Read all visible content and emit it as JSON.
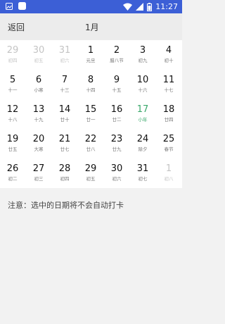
{
  "status_bar": {
    "time": "11:27",
    "icons": [
      "notification-icon",
      "app-icon",
      "wifi-icon",
      "signal-icon",
      "battery-icon"
    ],
    "color": "#3c5fd6"
  },
  "header": {
    "back_label": "返回",
    "month_title": "1月"
  },
  "calendar": {
    "today_color": "#3aa86b",
    "weeks": [
      [
        {
          "day": "29",
          "lunar": "初四",
          "faded": true
        },
        {
          "day": "30",
          "lunar": "初五",
          "faded": true
        },
        {
          "day": "31",
          "lunar": "初六",
          "faded": true
        },
        {
          "day": "1",
          "lunar": "元旦"
        },
        {
          "day": "2",
          "lunar": "腊八节"
        },
        {
          "day": "3",
          "lunar": "初九"
        },
        {
          "day": "4",
          "lunar": "初十"
        }
      ],
      [
        {
          "day": "5",
          "lunar": "十一"
        },
        {
          "day": "6",
          "lunar": "小寒"
        },
        {
          "day": "7",
          "lunar": "十三"
        },
        {
          "day": "8",
          "lunar": "十四"
        },
        {
          "day": "9",
          "lunar": "十五"
        },
        {
          "day": "10",
          "lunar": "十六"
        },
        {
          "day": "11",
          "lunar": "十七"
        }
      ],
      [
        {
          "day": "12",
          "lunar": "十八"
        },
        {
          "day": "13",
          "lunar": "十九"
        },
        {
          "day": "14",
          "lunar": "廿十"
        },
        {
          "day": "15",
          "lunar": "廿一"
        },
        {
          "day": "16",
          "lunar": "廿二"
        },
        {
          "day": "17",
          "lunar": "小年",
          "today": true
        },
        {
          "day": "18",
          "lunar": "廿四"
        }
      ],
      [
        {
          "day": "19",
          "lunar": "廿五"
        },
        {
          "day": "20",
          "lunar": "大寒"
        },
        {
          "day": "21",
          "lunar": "廿七"
        },
        {
          "day": "22",
          "lunar": "廿八"
        },
        {
          "day": "23",
          "lunar": "廿九"
        },
        {
          "day": "24",
          "lunar": "除夕"
        },
        {
          "day": "25",
          "lunar": "春节"
        }
      ],
      [
        {
          "day": "26",
          "lunar": "初二"
        },
        {
          "day": "27",
          "lunar": "初三"
        },
        {
          "day": "28",
          "lunar": "初四"
        },
        {
          "day": "29",
          "lunar": "初五"
        },
        {
          "day": "30",
          "lunar": "初六"
        },
        {
          "day": "31",
          "lunar": "初七"
        },
        {
          "day": "1",
          "lunar": "初八",
          "faded": true
        }
      ]
    ]
  },
  "note": "注意：选中的日期将不会自动打卡"
}
